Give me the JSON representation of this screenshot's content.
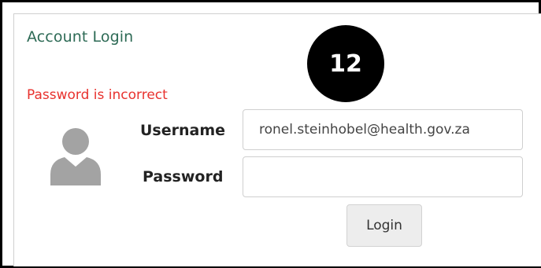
{
  "login": {
    "title": "Account Login",
    "error_message": "Password is incorrect",
    "username_label": "Username",
    "username_value": "ronel.steinhobel@health.gov.za",
    "password_label": "Password",
    "password_value": "",
    "login_button": "Login"
  },
  "annotation": {
    "step_number": "12"
  },
  "icons": {
    "avatar": "user-silhouette-icon"
  },
  "colors": {
    "title": "#2d6a55",
    "error": "#e8322e",
    "badge_bg": "#000000",
    "button_bg": "#ededed"
  }
}
